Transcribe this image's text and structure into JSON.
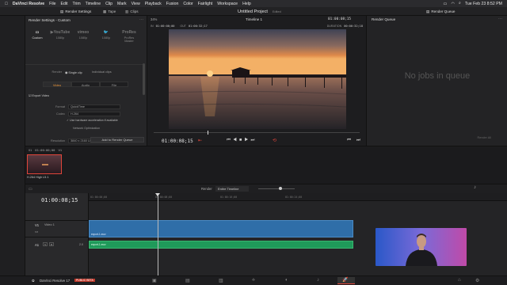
{
  "menubar": {
    "app": "DaVinci Resolve",
    "items": [
      "File",
      "Edit",
      "Trim",
      "Timeline",
      "Clip",
      "Mark",
      "View",
      "Playback",
      "Fusion",
      "Color",
      "Fairlight",
      "Workspace",
      "Help"
    ],
    "clock": "Tue Feb 23  8:52 PM"
  },
  "toolbar": {
    "render_settings": "Render Settings",
    "tape": "Tape",
    "clips": "Clips",
    "zoom": "34%",
    "project_title": "Untitled Project",
    "edited": "Edited",
    "timeline_name": "Timeline 1",
    "timecode_top": "01:00:08;15",
    "render_queue": "Render Queue"
  },
  "render_settings": {
    "title": "Render Settings - Custom",
    "presets": [
      {
        "logo": "YouTube",
        "label": "Custom"
      },
      {
        "logo": "▶YouTube",
        "label": "1080p"
      },
      {
        "logo": "vimeo",
        "label": "1080p"
      },
      {
        "logo": "Twitter",
        "label": "1080p"
      },
      {
        "logo": "ProRes",
        "label": "ProRes Master"
      }
    ],
    "render_label": "Render",
    "single_clip": "Single clip",
    "individual_clips": "Individual clips",
    "tabs": [
      "Video",
      "Audio",
      "File"
    ],
    "export_video": "Export Video",
    "format_label": "Format",
    "format_value": "QuickTime",
    "codec_label": "Codec",
    "codec_value": "H.264",
    "hw_accel": "Use hardware acceleration if available",
    "network_opt": "Network Optimization",
    "resolution_label": "Resolution",
    "resolution_value": "3840 x 2160 Ultra HD",
    "add_button": "Add to Render Queue"
  },
  "viewer": {
    "in_label": "IN",
    "in_tc": "01:00:00;00",
    "out_label": "OUT",
    "out_tc": "01:00:32;17",
    "duration_label": "DURATION",
    "duration_tc": "00:00:32;18",
    "current_tc": "01:00:08;15"
  },
  "render_queue": {
    "empty": "No jobs in queue",
    "render_all": "Render All"
  },
  "bin": {
    "clip_number": "01",
    "clip_tc": "01:00:00;00",
    "clip_track": "V1",
    "clip_codec": "H.264 High L5.1"
  },
  "timeline": {
    "render_label": "Render",
    "render_range": "Entire Timeline",
    "timecode": "01:00:08;15",
    "ruler": [
      "01:00:00;00",
      "01:00:08;00",
      "01:00:16;00",
      "01:00:24;00"
    ],
    "v1_label": "V1",
    "v1_name": "Video 1",
    "a1_label": "A1",
    "a1_level": "2.0",
    "video_clip": "export-1.mov",
    "audio_clip": "export-1.mov"
  },
  "pages": {
    "app": "DaVinci Resolve 17",
    "badge": "PUBLIC BETA"
  },
  "colors": {
    "accent_orange": "#f39a3a",
    "clip_blue": "#2f6ea8",
    "clip_green": "#1f9a5a",
    "playhead_red": "#e0453a"
  }
}
